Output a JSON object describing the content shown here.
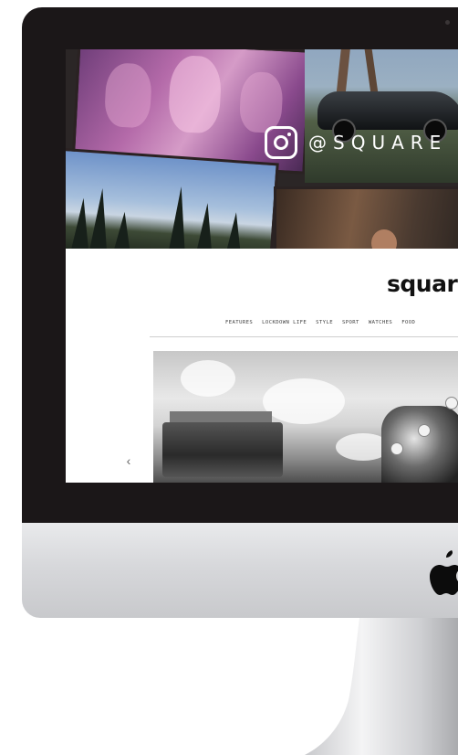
{
  "device": {
    "name": "iMac"
  },
  "instagram_banner": {
    "icon": "instagram-icon",
    "handle": "@SQUARE"
  },
  "site": {
    "logo_text": "square"
  },
  "navigation": {
    "items": [
      "FEATURES",
      "LOCKDOWN LIFE",
      "STYLE",
      "SPORT",
      "WATCHES",
      "FOOD"
    ]
  },
  "carousel": {
    "prev_glyph": "‹"
  },
  "colors": {
    "bezel": "#1b1718",
    "chin": "#d7d8db",
    "logo_text": "#111111",
    "nav_text": "#444444"
  }
}
